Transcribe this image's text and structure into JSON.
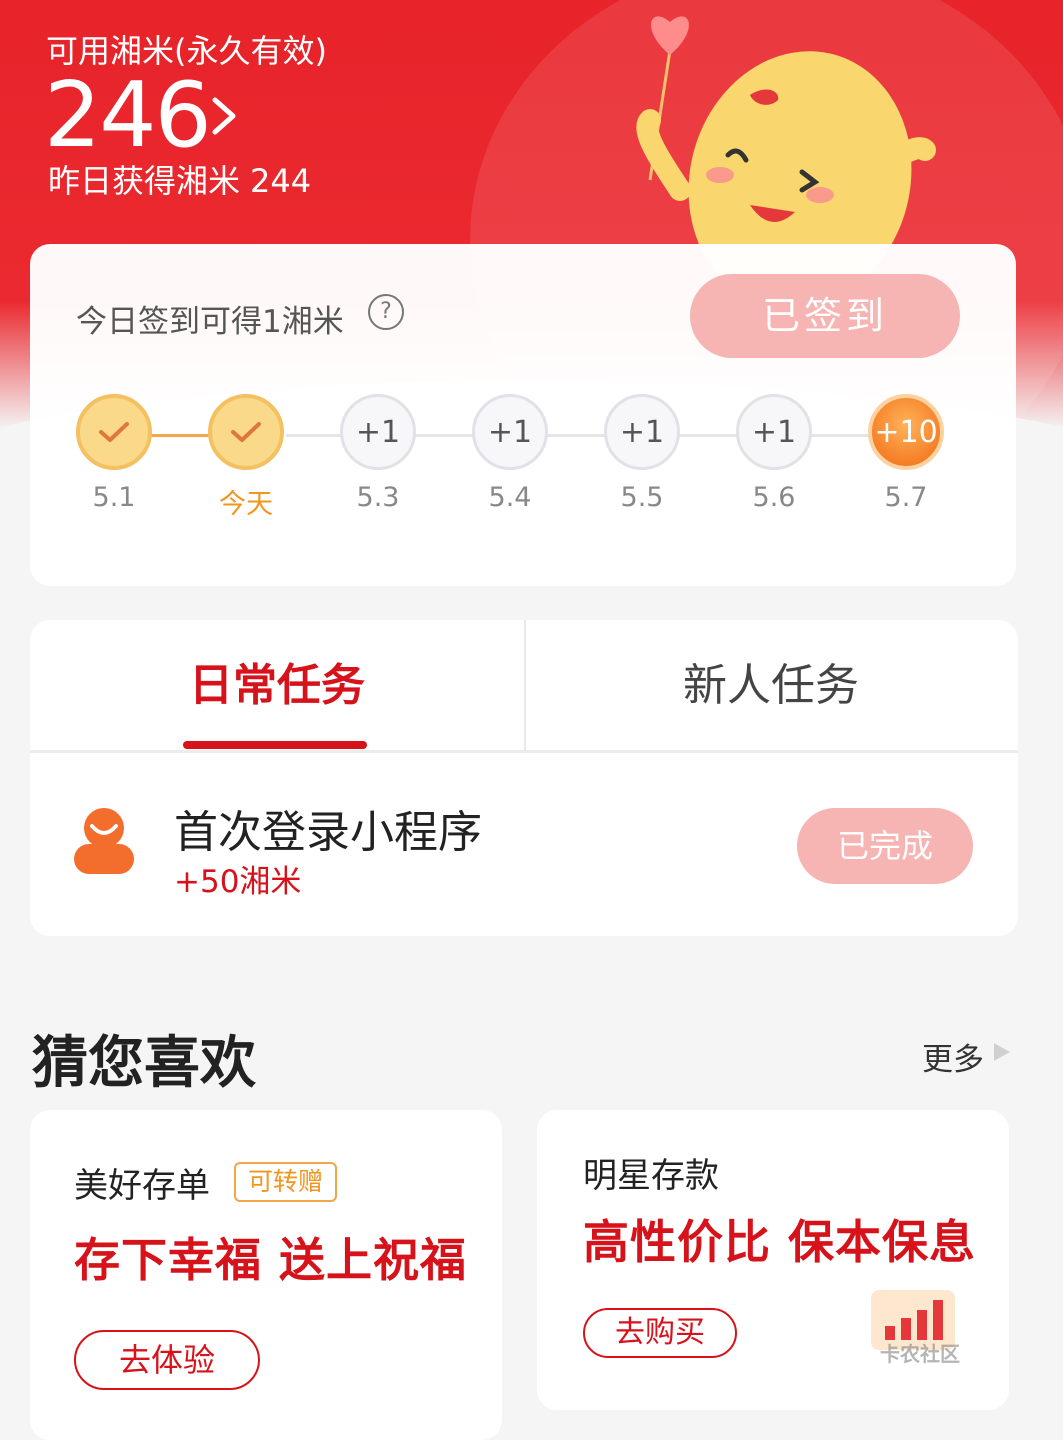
{
  "balance": {
    "label": "可用湘米(永久有效)",
    "value": "246",
    "yesterday_label": "昨日获得湘米",
    "yesterday_value": "244"
  },
  "signin": {
    "tip": "今日签到可得1湘米",
    "help": "?",
    "button_label": "已签到",
    "days": [
      {
        "reward": "",
        "label": "5.1",
        "state": "done"
      },
      {
        "reward": "",
        "label": "今天",
        "state": "done"
      },
      {
        "reward": "+1",
        "label": "5.3",
        "state": "pending"
      },
      {
        "reward": "+1",
        "label": "5.4",
        "state": "pending"
      },
      {
        "reward": "+1",
        "label": "5.5",
        "state": "pending"
      },
      {
        "reward": "+1",
        "label": "5.6",
        "state": "pending"
      },
      {
        "reward": "+10",
        "label": "5.7",
        "state": "bonus"
      }
    ]
  },
  "tasks": {
    "tabs": [
      "日常任务",
      "新人任务"
    ],
    "active_tab": "日常任务",
    "items": [
      {
        "title": "首次登录小程序",
        "reward": "+50湘米",
        "button": "已完成"
      }
    ]
  },
  "recommend": {
    "title": "猜您喜欢",
    "more": "更多",
    "products": [
      {
        "name": "美好存单",
        "tag": "可转赠",
        "slogan": "存下幸福 送上祝福",
        "button": "去体验"
      },
      {
        "name": "明星存款",
        "slogan": "高性价比 保本保息",
        "button": "去购买"
      }
    ]
  },
  "watermark": "卡农社区",
  "colors": {
    "brand_red": "#e8232a",
    "accent_orange": "#f2951e",
    "disabled_pink": "#f6b4b3"
  }
}
